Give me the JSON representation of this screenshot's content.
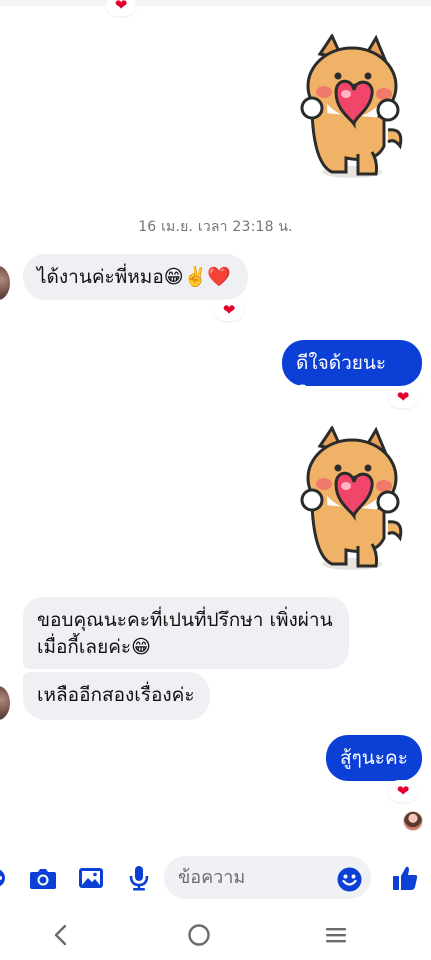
{
  "messages": {
    "timestamp": "16 เม.ย. เวลา 23:18 น.",
    "m1": "ได้งานค่ะพี่หมอ😁✌️❤️",
    "m2": "ดีใจด้วยนะคะ",
    "m3_line1": "ขอบคุณนะคะที่เปนที่ปรึกษา เพิ่งผ่าน",
    "m3_line2": "เมื่อกี้เลยค่ะ😁",
    "m4": "เหลืออีกสองเรื่องค่ะ",
    "m5": "สู้ๆนะคะ",
    "reaction": "❤"
  },
  "composer": {
    "placeholder": "ข้อความ"
  },
  "icons": {
    "left_partial": "more-icon",
    "camera": "camera-icon",
    "gallery": "gallery-icon",
    "mic": "microphone-icon",
    "emoji": "emoji-icon",
    "like": "thumbs-up-icon",
    "back": "nav-back-icon",
    "home": "nav-home-icon",
    "recents": "nav-recents-icon"
  },
  "colors": {
    "accent": "#0b3fd6",
    "reaction": "#e4002b",
    "incoming_bubble": "#eff0f4"
  }
}
